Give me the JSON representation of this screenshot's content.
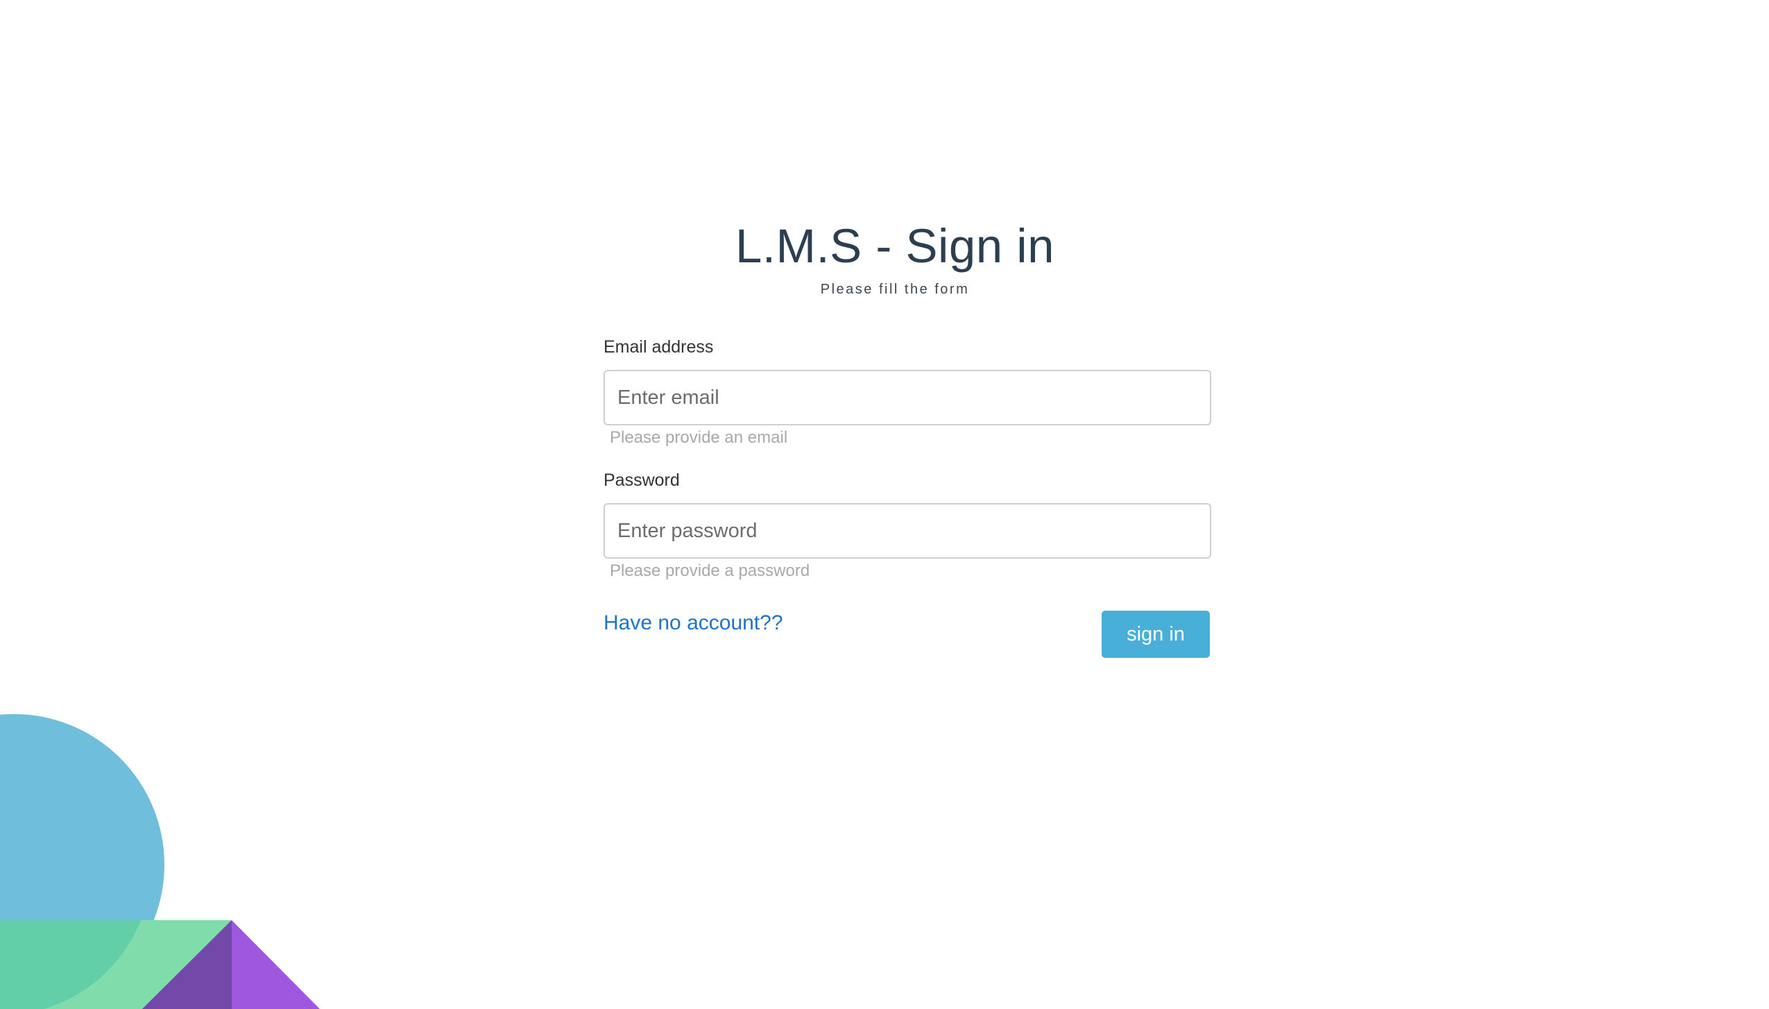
{
  "page": {
    "title": "L.M.S - Sign in",
    "subtitle": "Please fill the form"
  },
  "form": {
    "email": {
      "label": "Email address",
      "placeholder": "Enter email",
      "value": "",
      "help": "Please provide an email"
    },
    "password": {
      "label": "Password",
      "placeholder": "Enter password",
      "value": "",
      "help": "Please provide a password"
    },
    "signup_link": "Have no account??",
    "submit_label": "sign in"
  },
  "colors": {
    "title": "#2c3e50",
    "link": "#1f73c8",
    "button": "#47afd8",
    "help_text": "#a9a9a9",
    "decor_circle": "#6fbfdc",
    "decor_green": "#80dcaa",
    "decor_purple": "#a057df"
  }
}
